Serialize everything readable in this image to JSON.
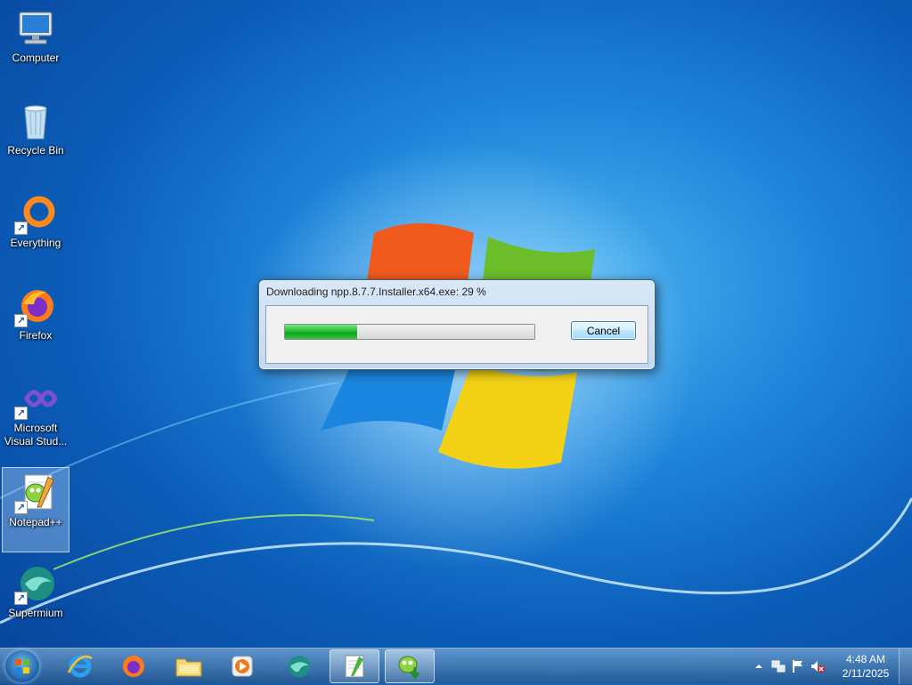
{
  "desktop": {
    "icons": [
      {
        "label": "Computer",
        "icon": "computer-icon",
        "shortcut": false
      },
      {
        "label": "Recycle Bin",
        "icon": "recycle-bin-icon",
        "shortcut": false
      },
      {
        "label": "Everything",
        "icon": "everything-icon",
        "shortcut": true
      },
      {
        "label": "Firefox",
        "icon": "firefox-icon",
        "shortcut": true
      },
      {
        "label": "Microsoft Visual Stud...",
        "icon": "visual-studio-icon",
        "shortcut": true
      },
      {
        "label": "Notepad++",
        "icon": "notepad-plus-plus-icon",
        "shortcut": true,
        "selected": true
      },
      {
        "label": "Supermium",
        "icon": "supermium-icon",
        "shortcut": true
      }
    ]
  },
  "dialog": {
    "title": "Downloading npp.8.7.7.Installer.x64.exe: 29 %",
    "progress_percent": 29,
    "cancel_label": "Cancel"
  },
  "taskbar": {
    "pinned": [
      {
        "icon": "internet-explorer-icon"
      },
      {
        "icon": "firefox-icon"
      },
      {
        "icon": "file-explorer-icon"
      },
      {
        "icon": "media-player-icon"
      },
      {
        "icon": "supermium-icon"
      },
      {
        "icon": "notepad-plus-plus-icon",
        "active": true
      },
      {
        "icon": "notepad-plus-plus-installer-icon",
        "active": true
      }
    ],
    "tray": {
      "icons": [
        "show-hidden-icons-arrow",
        "network-icon",
        "action-center-flag-icon",
        "volume-muted-icon"
      ],
      "time": "4:48 AM",
      "date": "2/11/2025"
    }
  },
  "colors": {
    "progress_fill": "#10a51d",
    "dialog_border": "#3a5f86",
    "wallpaper_blue": "#1f86db"
  }
}
